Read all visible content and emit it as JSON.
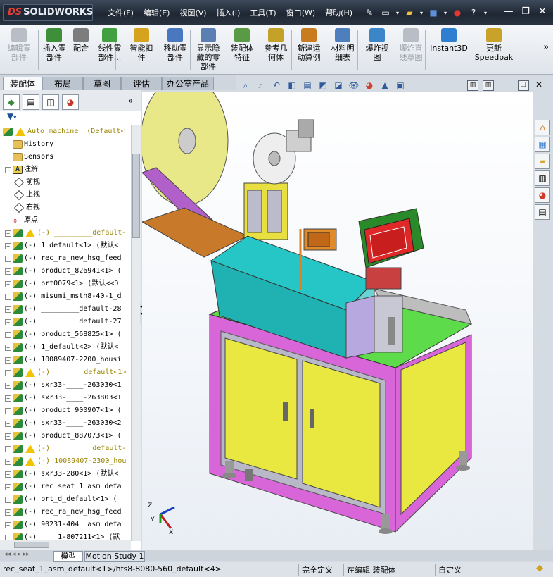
{
  "app": {
    "brand": "SOLIDWORKS",
    "brand_prefix": "DS"
  },
  "menu": [
    "文件(F)",
    "编辑(E)",
    "视图(V)",
    "插入(I)",
    "工具(T)",
    "窗口(W)",
    "帮助(H)"
  ],
  "ribbon": {
    "commands": [
      {
        "label": "编辑零\n部件",
        "disabled": true,
        "color": "#b9bec6"
      },
      {
        "label": "插入零\n部件",
        "disabled": false,
        "color": "#3e8f3a"
      },
      {
        "label": "配合",
        "disabled": false,
        "color": "#7d7d7d"
      },
      {
        "label": "线性零\n部件...",
        "disabled": false,
        "color": "#43a040"
      },
      {
        "label": "智能扣\n件",
        "disabled": false,
        "color": "#d6a31f"
      },
      {
        "label": "移动零\n部件",
        "disabled": false,
        "color": "#4978c0"
      },
      {
        "label": "显示隐\n藏的零\n部件",
        "disabled": false,
        "color": "#5b7fb2"
      },
      {
        "label": "装配体\n特征",
        "disabled": false,
        "color": "#5a9a44"
      },
      {
        "label": "参考几\n何体",
        "disabled": false,
        "color": "#c4a228"
      },
      {
        "label": "新建运\n动算例",
        "disabled": false,
        "color": "#c87c1e"
      },
      {
        "label": "材料明\n细表",
        "disabled": false,
        "color": "#4d7fbf"
      },
      {
        "label": "爆炸视\n图",
        "disabled": false,
        "color": "#3a86c8"
      },
      {
        "label": "爆炸直\n线草图",
        "disabled": true,
        "color": "#b9bec6"
      },
      {
        "label": "Instant3D",
        "disabled": false,
        "color": "#2f7fd0"
      },
      {
        "label": "更新\nSpeedpak",
        "disabled": false,
        "color": "#c9a22a"
      }
    ],
    "more": "»"
  },
  "tabs": [
    "装配体",
    "布局",
    "草图",
    "评估",
    "办公室产品"
  ],
  "active_tab": "装配体",
  "feature_tree": {
    "filter_icon": "filter-icon",
    "rows": [
      {
        "text": "Auto machine  (Default<",
        "icon": "part",
        "warn": true,
        "expand": "",
        "olive": true,
        "indent": 0
      },
      {
        "text": "History",
        "icon": "folder",
        "expand": "",
        "indent": 1
      },
      {
        "text": "Sensors",
        "icon": "folder",
        "expand": "",
        "indent": 1
      },
      {
        "text": "注解",
        "icon": "note",
        "expand": "+",
        "indent": 1
      },
      {
        "text": "前视",
        "icon": "plane",
        "expand": "",
        "indent": 1
      },
      {
        "text": "上视",
        "icon": "plane",
        "expand": "",
        "indent": 1
      },
      {
        "text": "右视",
        "icon": "plane",
        "expand": "",
        "indent": 1
      },
      {
        "text": "原点",
        "icon": "origin",
        "expand": "",
        "indent": 1
      },
      {
        "text": "(-) _________default-",
        "icon": "part",
        "warn": true,
        "expand": "+",
        "olive": true,
        "indent": 1
      },
      {
        "text": "(-) 1_default<1> (默认<",
        "icon": "part",
        "expand": "+",
        "indent": 1
      },
      {
        "text": "(-) rec_ra_new_hsg_feed",
        "icon": "part",
        "expand": "+",
        "indent": 1
      },
      {
        "text": "(-) product_826941<1> (",
        "icon": "part",
        "expand": "+",
        "indent": 1
      },
      {
        "text": "(-) prt0079<1> (默认<<D",
        "icon": "part",
        "expand": "+",
        "indent": 1
      },
      {
        "text": "(-) misumi_msth8-40-1_d",
        "icon": "part",
        "expand": "+",
        "indent": 1
      },
      {
        "text": "(-) _________default-28",
        "icon": "part",
        "expand": "+",
        "indent": 1
      },
      {
        "text": "(-) _________default-27",
        "icon": "part",
        "expand": "+",
        "indent": 1
      },
      {
        "text": "(-) product_568825<1> (",
        "icon": "part",
        "expand": "+",
        "indent": 1
      },
      {
        "text": "(-) 1_default<2> (默认<",
        "icon": "part",
        "expand": "+",
        "indent": 1
      },
      {
        "text": "(-) 10089407-2200_housi",
        "icon": "part",
        "expand": "+",
        "indent": 1
      },
      {
        "text": "(-) _______default<1>",
        "icon": "part",
        "warn": true,
        "expand": "+",
        "olive": true,
        "indent": 1
      },
      {
        "text": "(-) sxr33-____-263030<1",
        "icon": "part",
        "expand": "+",
        "indent": 1
      },
      {
        "text": "(-) sxr33-____-263803<1",
        "icon": "part",
        "expand": "+",
        "indent": 1
      },
      {
        "text": "(-) product_900907<1> (",
        "icon": "part",
        "expand": "+",
        "indent": 1
      },
      {
        "text": "(-) sxr33-____-263030<2",
        "icon": "part",
        "expand": "+",
        "indent": 1
      },
      {
        "text": "(-) product_887073<1> (",
        "icon": "part",
        "expand": "+",
        "indent": 1
      },
      {
        "text": "(-) _________default-",
        "icon": "part",
        "warn": true,
        "expand": "+",
        "olive": true,
        "indent": 1
      },
      {
        "text": "(-) 10089407-2300_hou",
        "icon": "part",
        "warn": true,
        "expand": "+",
        "olive": true,
        "indent": 1
      },
      {
        "text": "(-) sxr33-280<1> (默认<",
        "icon": "part",
        "expand": "+",
        "indent": 1
      },
      {
        "text": "(-) rec_seat_1_asm_defa",
        "icon": "part",
        "expand": "+",
        "indent": 1
      },
      {
        "text": "(-) prt_d_default<1> (",
        "icon": "part",
        "expand": "+",
        "indent": 1
      },
      {
        "text": "(-) rec_ra_new_hsg_feed",
        "icon": "part",
        "expand": "+",
        "indent": 1
      },
      {
        "text": "(-) 90231-404__asm_defa",
        "icon": "part",
        "expand": "+",
        "indent": 1
      },
      {
        "text": "(-) ____1-807211<1> (默",
        "icon": "part",
        "expand": "+",
        "indent": 1
      }
    ]
  },
  "bottom_tabs": [
    "模型",
    "Motion Study 1"
  ],
  "status": {
    "path": "rec_seat_1_asm_default<1>/hfs8-8080-560_default<4>",
    "defined": "完全定义",
    "editing": "在编辑 装配体",
    "custom": "自定义"
  }
}
